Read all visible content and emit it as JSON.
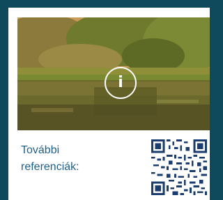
{
  "references": {
    "line1": "További",
    "line2": "referenciák:"
  },
  "info_button": {
    "glyph": "i",
    "icon": "info-icon"
  },
  "photo": {
    "subject": "lake-with-reeds-and-trees-photo"
  },
  "qr": {
    "icon": "qr-code"
  },
  "colors": {
    "background": "#0f4a5c",
    "card": "#ffffff",
    "label_text": "#1f5f8b",
    "qr": "#1a3c6e"
  }
}
